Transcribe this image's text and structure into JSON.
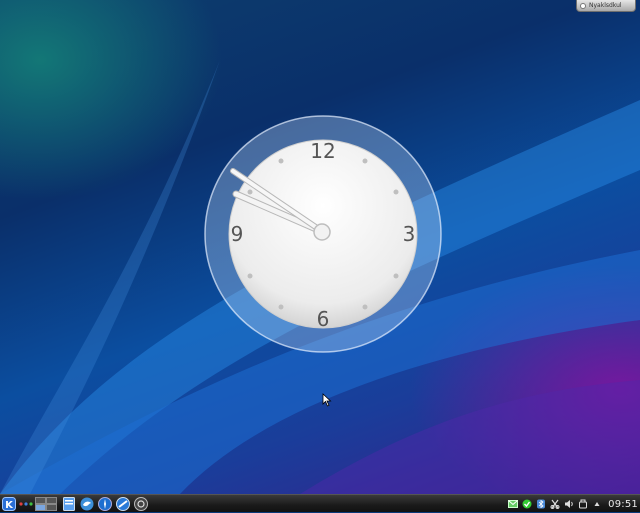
{
  "toolbox": {
    "label": "Nyaklsdkul"
  },
  "clock": {
    "numerals": {
      "twelve": "12",
      "three": "3",
      "six": "6",
      "nine": "9"
    },
    "time_shown": "09:51"
  },
  "panel": {
    "launcher_icon": "kde-logo-icon",
    "pager_icon": "virtual-desktop-pager-icon",
    "task_icons": [
      "file-manager-icon",
      "bird-icon",
      "browser-icon",
      "network-icon",
      "system-monitor-icon"
    ],
    "tray_icons": [
      "email-icon",
      "update-check-icon",
      "bluetooth-icon",
      "clipboard-icon",
      "volume-icon",
      "device-notifier-icon",
      "expand-tray-icon"
    ],
    "clock_text": "09:51"
  }
}
